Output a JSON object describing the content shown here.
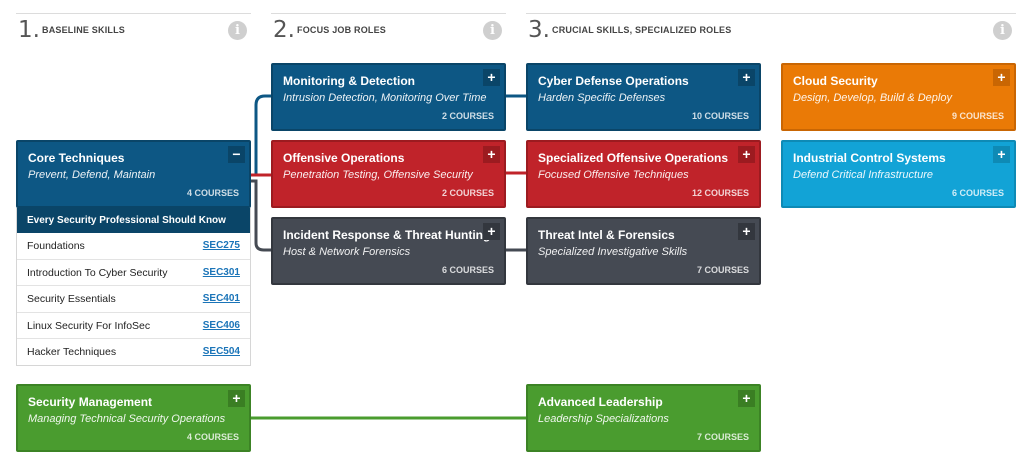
{
  "columns": [
    {
      "num": "1.",
      "title": "BASELINE SKILLS",
      "info": "i"
    },
    {
      "num": "2.",
      "title": "FOCUS JOB ROLES",
      "info": "i"
    },
    {
      "num": "3.",
      "title": "CRUCIAL SKILLS, SPECIALIZED ROLES",
      "info": "i"
    }
  ],
  "cards": {
    "core": {
      "title": "Core Techniques",
      "subtitle": "Prevent, Defend, Maintain",
      "count": "4 COURSES",
      "toggle": "−"
    },
    "monitoring": {
      "title": "Monitoring & Detection",
      "subtitle": "Intrusion Detection, Monitoring Over Time",
      "count": "2 COURSES",
      "toggle": "+"
    },
    "offensive": {
      "title": "Offensive Operations",
      "subtitle": "Penetration Testing, Offensive Security",
      "count": "2 COURSES",
      "toggle": "+"
    },
    "incident": {
      "title": "Incident Response & Threat Hunting",
      "subtitle": "Host & Network Forensics",
      "count": "6 COURSES",
      "toggle": "+"
    },
    "cyberdefense": {
      "title": "Cyber Defense Operations",
      "subtitle": "Harden Specific Defenses",
      "count": "10 COURSES",
      "toggle": "+"
    },
    "specoffensive": {
      "title": "Specialized Offensive Operations",
      "subtitle": "Focused Offensive Techniques",
      "count": "12 COURSES",
      "toggle": "+"
    },
    "threatintel": {
      "title": "Threat Intel & Forensics",
      "subtitle": "Specialized Investigative Skills",
      "count": "7 COURSES",
      "toggle": "+"
    },
    "cloud": {
      "title": "Cloud Security",
      "subtitle": "Design, Develop, Build & Deploy",
      "count": "9 COURSES",
      "toggle": "+"
    },
    "ics": {
      "title": "Industrial Control Systems",
      "subtitle": "Defend Critical Infrastructure",
      "count": "6 COURSES",
      "toggle": "+"
    },
    "secmgmt": {
      "title": "Security Management",
      "subtitle": "Managing Technical Security Operations",
      "count": "4 COURSES",
      "toggle": "+"
    },
    "leadership": {
      "title": "Advanced Leadership",
      "subtitle": "Leadership Specializations",
      "count": "7 COURSES",
      "toggle": "+"
    }
  },
  "core_panel": {
    "header": "Every Security Professional Should Know",
    "courses": [
      {
        "name": "Foundations",
        "code": "SEC275"
      },
      {
        "name": "Introduction To Cyber Security",
        "code": "SEC301"
      },
      {
        "name": "Security Essentials",
        "code": "SEC401"
      },
      {
        "name": "Linux Security For InfoSec",
        "code": "SEC406"
      },
      {
        "name": "Hacker Techniques",
        "code": "SEC504"
      }
    ]
  },
  "colors": {
    "blue": "#0d5784",
    "red": "#c0232a",
    "dark": "#454a53",
    "orange": "#ea7a06",
    "cyan": "#12a3d6",
    "green": "#4a9c2f"
  }
}
